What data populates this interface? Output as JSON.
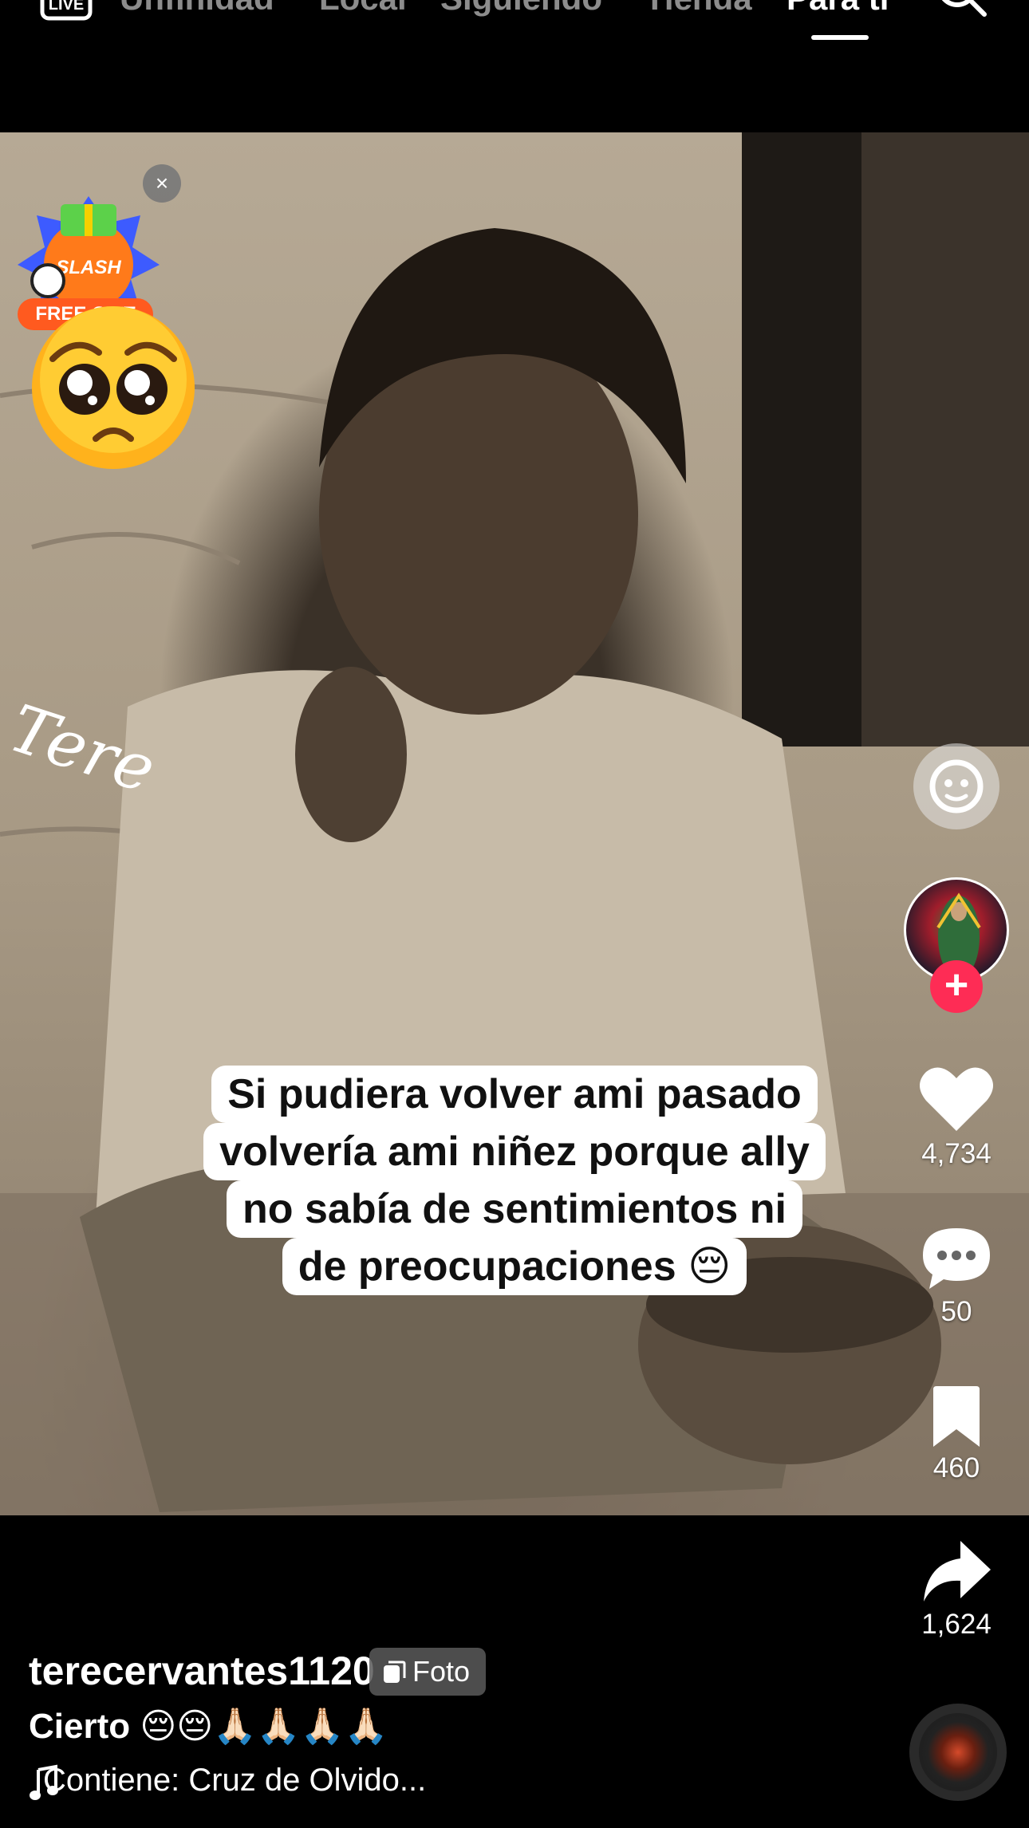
{
  "top_nav": {
    "live_label": "LIVE",
    "tabs": [
      "Unfinidad",
      "Local",
      "Siguiendo",
      "Tienda",
      "Para ti"
    ],
    "active_tab": "Para ti"
  },
  "post": {
    "watermark": "Tere",
    "caption_lines": [
      "Si pudiera volver ami pasado",
      "volvería ami niñez porque ally",
      "no sabía de sentimientos ni",
      "de preocupaciones 😔"
    ],
    "gift_badge": {
      "slash_label": "SLASH",
      "free_gift_label": "FREE GIFT",
      "close_label": "×"
    }
  },
  "actions": {
    "likes": "4,734",
    "comments": "50",
    "saves": "460",
    "shares": "1,624",
    "follow_label": "+"
  },
  "author": {
    "username": "terecervantes1120",
    "type_badge": "Foto",
    "description": "Cierto 😔😔🙏🏻🙏🏻🙏🏻🙏🏻",
    "music": "Contiene: Cruz de Olvido..."
  },
  "colors": {
    "accent_red": "#fe2c55",
    "gift_orange": "#ff5a1f"
  }
}
